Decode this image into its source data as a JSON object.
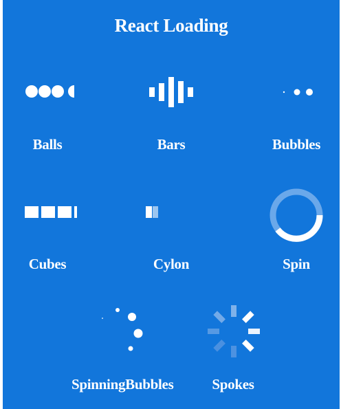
{
  "title": "React Loading",
  "accent": "#1276db",
  "loaders": [
    {
      "label": "Balls",
      "icon": "balls-icon"
    },
    {
      "label": "Bars",
      "icon": "bars-icon"
    },
    {
      "label": "Bubbles",
      "icon": "bubbles-icon"
    },
    {
      "label": "Cubes",
      "icon": "cubes-icon"
    },
    {
      "label": "Cylon",
      "icon": "cylon-icon"
    },
    {
      "label": "Spin",
      "icon": "spin-icon"
    },
    {
      "label": "SpinningBubbles",
      "icon": "spinning-bubbles-icon"
    },
    {
      "label": "Spokes",
      "icon": "spokes-icon"
    }
  ]
}
